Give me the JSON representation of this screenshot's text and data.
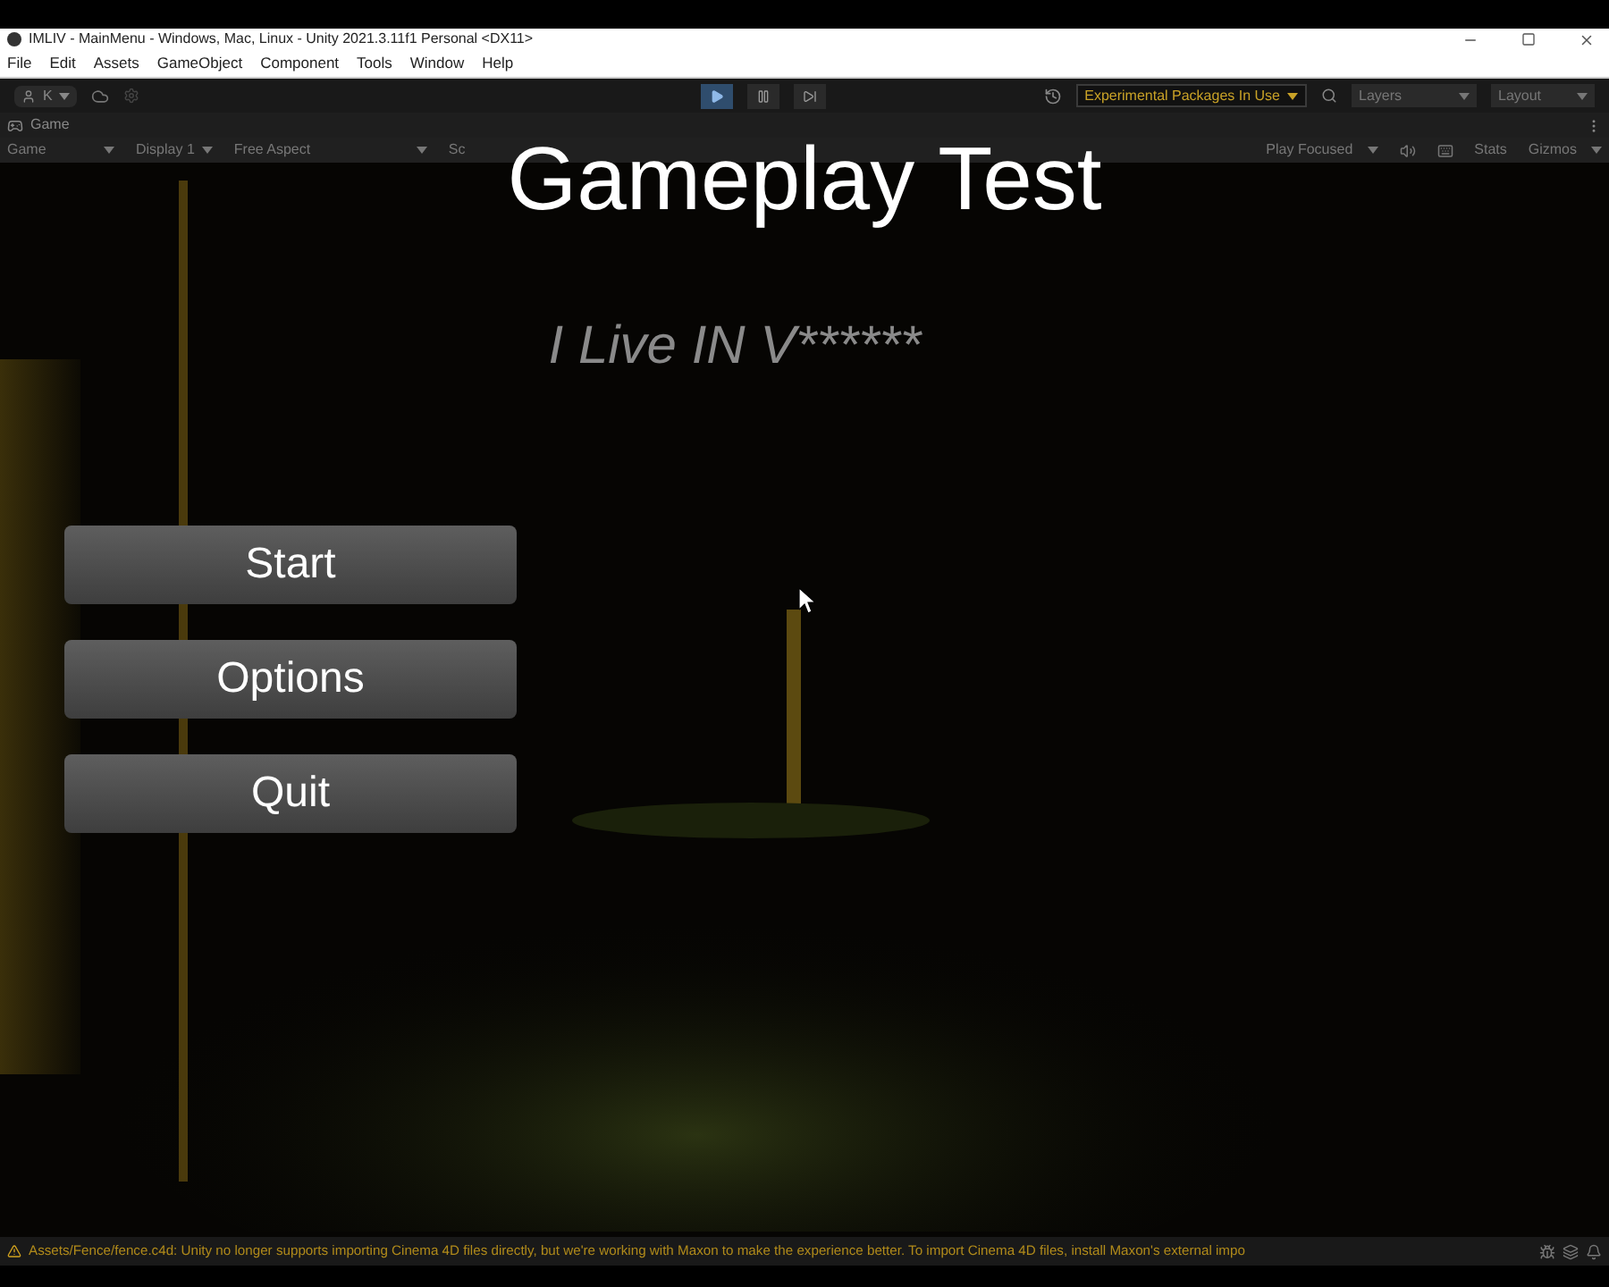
{
  "window": {
    "title": "IMLIV - MainMenu - Windows, Mac, Linux - Unity 2021.3.11f1 Personal <DX11>"
  },
  "menu": [
    "File",
    "Edit",
    "Assets",
    "GameObject",
    "Component",
    "Tools",
    "Window",
    "Help"
  ],
  "toolbar": {
    "account": "K",
    "play_selected": true,
    "packages_notice": "Experimental Packages In Use",
    "layers": "Layers",
    "layout": "Layout"
  },
  "game_tab": {
    "label": "Game"
  },
  "game_toolbar": {
    "view": "Game",
    "display": "Display 1",
    "aspect": "Free Aspect",
    "scale_label": "Sc",
    "play_mode": "Play Focused",
    "stats": "Stats",
    "gizmos": "Gizmos"
  },
  "overlay_caption": "Gameplay Test",
  "game": {
    "subtitle": "I Live IN V******",
    "buttons": [
      "Start",
      "Options",
      "Quit"
    ]
  },
  "status_bar": {
    "message": "Assets/Fence/fence.c4d: Unity no longer supports importing Cinema 4D files directly, but we're working with Maxon to make the experience better. To import Cinema 4D files, install Maxon's external impo"
  }
}
